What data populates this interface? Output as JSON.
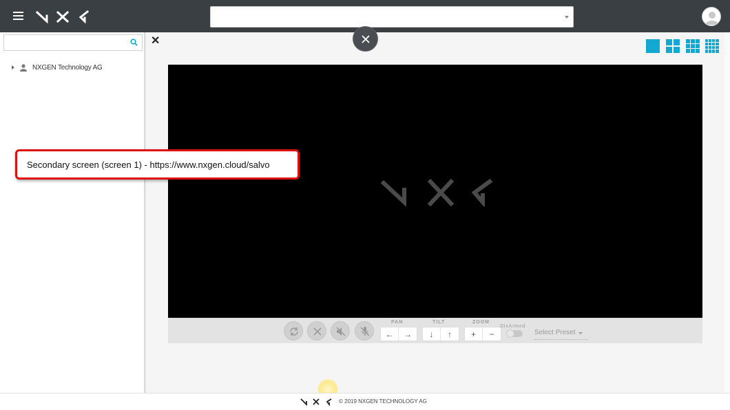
{
  "header": {
    "menu_icon": "hamburger-icon",
    "logo": "NXG",
    "camera_select_value": "",
    "avatar_icon": "user-avatar-icon"
  },
  "sidebar": {
    "search_placeholder": "",
    "search_icon": "search-icon",
    "tree": [
      {
        "label": "NXGEN Technology AG",
        "icon": "user-icon",
        "expand_icon": "caret-right-icon"
      }
    ]
  },
  "main": {
    "close_icon": "close-icon",
    "layouts": [
      {
        "name": "layout-1x1",
        "icon": "grid-1-icon",
        "active": true
      },
      {
        "name": "layout-2x2",
        "icon": "grid-4-icon",
        "active": false
      },
      {
        "name": "layout-3x3",
        "icon": "grid-9-icon",
        "active": false
      },
      {
        "name": "layout-4x4",
        "icon": "grid-16-icon",
        "active": false
      }
    ],
    "video_logo": "NXG",
    "controls": {
      "buttons": [
        "refresh-icon",
        "close-icon",
        "mute-icon",
        "mic-off-icon"
      ],
      "pan_label": "PAN",
      "tilt_label": "TILT",
      "zoom_label": "ZOOM",
      "pan_left": "←",
      "pan_right": "→",
      "tilt_down": "↓",
      "tilt_up": "↑",
      "zoom_in": "+",
      "zoom_out": "−",
      "armed_label": "DisArmed",
      "armed": false,
      "preset_value": "Select Preset"
    }
  },
  "overlay": {
    "close_icon": "close-icon",
    "callout_text": "Secondary screen (screen 1) - https://www.nxgen.cloud/salvo"
  },
  "footer": {
    "copyright": "© 2019 NXGEN TECHNOLOGY AG"
  },
  "colors": {
    "header_bg": "#3a3f44",
    "accent": "#12a8d0",
    "callout_border": "#e01010"
  }
}
